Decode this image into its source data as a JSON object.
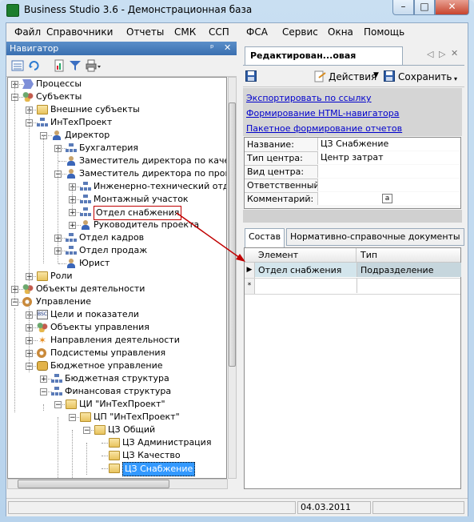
{
  "window": {
    "title": "Business Studio 3.6 - Демонстрационная база",
    "min_glyph": "–",
    "max_glyph": "□",
    "close_glyph": "✕"
  },
  "menu": [
    "Файл",
    "Справочники",
    "Отчеты",
    "СМК",
    "ССП",
    "ФСА",
    "Сервис",
    "Окна",
    "Помощь"
  ],
  "navigator": {
    "title": "Навигатор",
    "pin_glyph": "ᵖ",
    "close_glyph": "✕"
  },
  "tree": [
    {
      "label": "Процессы",
      "icon": "process-icon",
      "expander": "+"
    },
    {
      "label": "Субъекты",
      "icon": "subjects-icon",
      "expander": "−"
    },
    {
      "label": "Внешние субъекты",
      "icon": "folder-icon",
      "expander": "+"
    },
    {
      "label": "ИнТехПроект",
      "icon": "org-icon",
      "expander": "−"
    },
    {
      "label": "Директор",
      "icon": "person-icon",
      "expander": "−"
    },
    {
      "label": "Бухгалтерия",
      "icon": "org-icon",
      "expander": "+"
    },
    {
      "label": "Заместитель директора по качес",
      "icon": "person-icon",
      "expander": ""
    },
    {
      "label": "Заместитель директора по произ",
      "icon": "person-icon",
      "expander": "−"
    },
    {
      "label": "Инженерно-технический отде",
      "icon": "org-icon",
      "expander": "+"
    },
    {
      "label": "Монтажный участок",
      "icon": "org-icon",
      "expander": "+"
    },
    {
      "label": "Отдел снабжения",
      "icon": "org-icon",
      "expander": "+"
    },
    {
      "label": "Руководитель проекта",
      "icon": "person-icon",
      "expander": "+"
    },
    {
      "label": "Отдел кадров",
      "icon": "org-icon",
      "expander": "+"
    },
    {
      "label": "Отдел продаж",
      "icon": "org-icon",
      "expander": "+"
    },
    {
      "label": "Юрист",
      "icon": "person-icon",
      "expander": ""
    },
    {
      "label": "Роли",
      "icon": "folder-icon",
      "expander": "+"
    },
    {
      "label": "Объекты деятельности",
      "icon": "objects-icon",
      "expander": "+"
    },
    {
      "label": "Управление",
      "icon": "management-icon",
      "expander": "−"
    },
    {
      "label": "Цели и показатели",
      "icon": "bsc-icon",
      "expander": "+"
    },
    {
      "label": "Объекты управления",
      "icon": "objects-icon",
      "expander": "+"
    },
    {
      "label": "Направления деятельности",
      "icon": "star-icon",
      "expander": "+"
    },
    {
      "label": "Подсистемы управления",
      "icon": "cog-icon",
      "expander": "+"
    },
    {
      "label": "Бюджетное управление",
      "icon": "budget-icon",
      "expander": "−"
    },
    {
      "label": "Бюджетная структура",
      "icon": "org-icon",
      "expander": "+"
    },
    {
      "label": "Финансовая структура",
      "icon": "org-icon",
      "expander": "−"
    },
    {
      "label": "ЦИ \"ИнТехПроект\"",
      "icon": "folder-icon",
      "expander": "−"
    },
    {
      "label": "ЦП \"ИнТехПроект\"",
      "icon": "folder-icon",
      "expander": "−"
    },
    {
      "label": "ЦЗ Общий",
      "icon": "folder-icon",
      "expander": "−"
    },
    {
      "label": "ЦЗ Администрация",
      "icon": "folder-icon",
      "expander": ""
    },
    {
      "label": "ЦЗ Качество",
      "icon": "folder-icon",
      "expander": ""
    },
    {
      "label": "ЦЗ Снабжение",
      "icon": "folder-icon",
      "expander": ""
    }
  ],
  "editor": {
    "tab_label": "Редактирован...овая  структура",
    "actions_label": "Действия",
    "save_label": "Сохранить",
    "links": [
      "Экспортировать по ссылку",
      "Формирование HTML-навигатора",
      "Пакетное формирование отчетов"
    ],
    "properties": [
      {
        "name": "Название:",
        "value": "ЦЗ Снабжение"
      },
      {
        "name": "Тип центра:",
        "value": "Центр затрат"
      },
      {
        "name": "Вид центра:",
        "value": ""
      },
      {
        "name": "Ответственный:",
        "value": ""
      },
      {
        "name": "Комментарий:",
        "value": ""
      }
    ],
    "comment_button": "a",
    "tabs": [
      "Состав",
      "Нормативно-справочные документы"
    ],
    "grid": {
      "columns": [
        "Элемент",
        "Тип"
      ],
      "rows": [
        {
          "element": "Отдел снабжения",
          "type": "Подразделение",
          "marker": "▶"
        }
      ],
      "new_row_marker": "*"
    }
  },
  "status": {
    "date": "04.03.2011"
  },
  "colors": {
    "accent": "#3399ff",
    "annotation": "#c00000"
  }
}
